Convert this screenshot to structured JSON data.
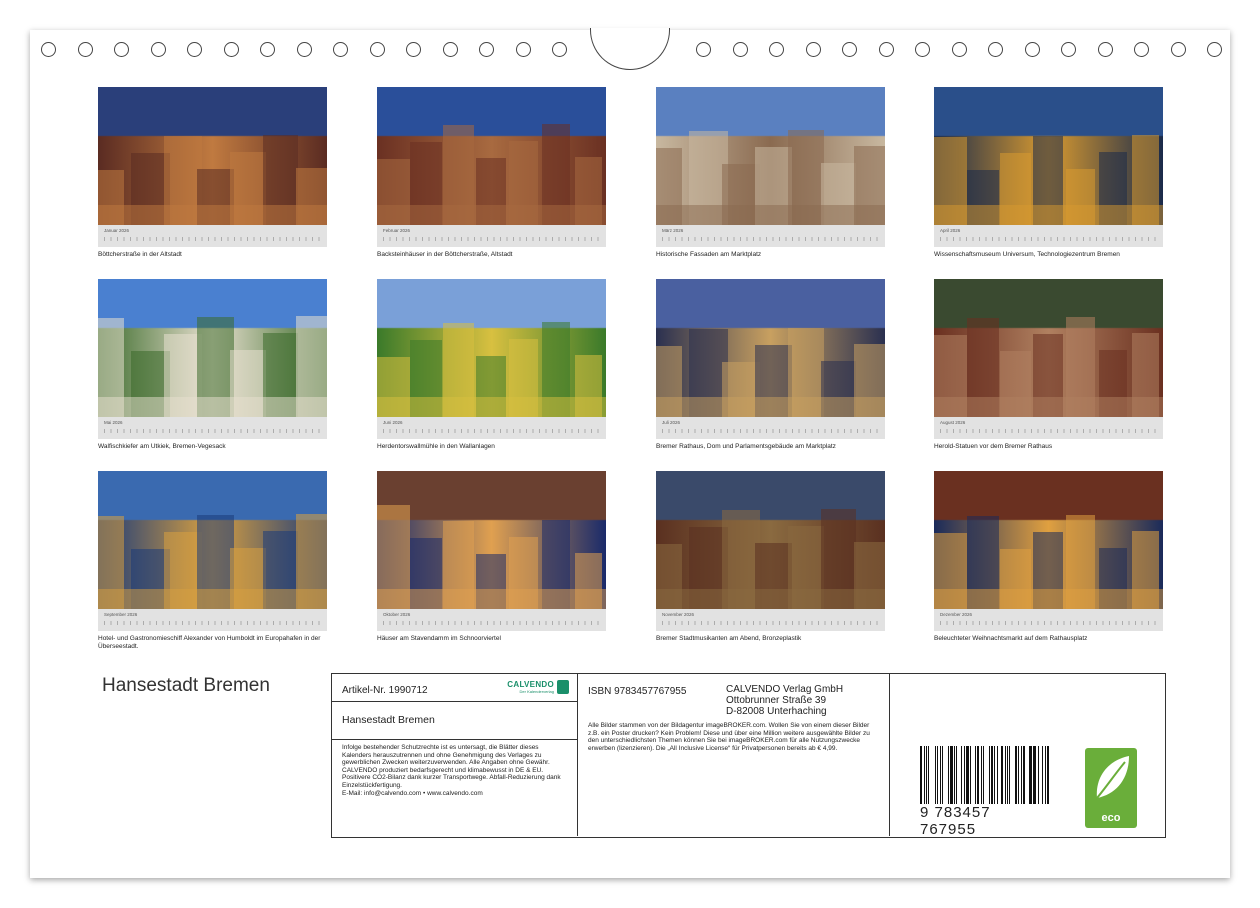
{
  "months": [
    {
      "name": "Januar 2026",
      "caption": "Böttcherstraße in der Altstadt",
      "palette": [
        "#5a2b22",
        "#2a3f7a",
        "#c07a40"
      ]
    },
    {
      "name": "Februar 2026",
      "caption": "Backsteinhäuser in der Böttcherstraße, Altstadt",
      "palette": [
        "#6a3022",
        "#2a4f9a",
        "#a86a40"
      ]
    },
    {
      "name": "März 2026",
      "caption": "Historische Fassaden am Marktplatz",
      "palette": [
        "#c8b8a0",
        "#5a80c0",
        "#8a6a50"
      ]
    },
    {
      "name": "April 2026",
      "caption": "Wissenschaftsmuseum Universum, Technologiezentrum Bremen",
      "palette": [
        "#1a2a4a",
        "#2a4f8a",
        "#d89a30"
      ]
    },
    {
      "name": "Mai 2026",
      "caption": "Walfischkiefer am Utkiek, Bremen-Vegesack",
      "palette": [
        "#3a6a2a",
        "#4a80d0",
        "#e8e0d0"
      ]
    },
    {
      "name": "Juni 2026",
      "caption": "Herdentorswallmühle in den Wallanlagen",
      "palette": [
        "#3a7a2a",
        "#7aa0d8",
        "#d8c040"
      ]
    },
    {
      "name": "Juli 2026",
      "caption": "Bremer Rathaus, Dom und Parlamentsgebäude am Marktplatz",
      "palette": [
        "#2a3050",
        "#4a60a0",
        "#c8a060"
      ]
    },
    {
      "name": "August 2026",
      "caption": "Herold-Statuen vor dem Bremer Rathaus",
      "palette": [
        "#6a3020",
        "#3a4a30",
        "#b08060"
      ]
    },
    {
      "name": "September 2026",
      "caption": "Hotel- und Gastronomieschiff Alexander von Humboldt im Europahafen in der Überseestadt.",
      "palette": [
        "#1a3a7a",
        "#3a6ab0",
        "#d8a040"
      ]
    },
    {
      "name": "Oktober 2026",
      "caption": "Häuser am Stavendamm im Schnoorviertel",
      "palette": [
        "#1a2a6a",
        "#6a4030",
        "#e0a050"
      ]
    },
    {
      "name": "November 2026",
      "caption": "Bremer Stadtmusikanten am Abend, Bronzeplastik",
      "palette": [
        "#5a3020",
        "#3a4a6a",
        "#8a6a40"
      ]
    },
    {
      "name": "Dezember 2026",
      "caption": "Beleuchteter Weihnachtsmarkt auf dem Rathausplatz",
      "palette": [
        "#1a2a5a",
        "#6a3020",
        "#e0a040"
      ]
    }
  ],
  "title": "Hansestadt Bremen",
  "panel": {
    "article": "Artikel-Nr. 1990712",
    "logo_text": "CALVENDO",
    "logo_sub": "Der Kalenderverlag",
    "product_title": "Hansestadt Bremen",
    "legal": "Infolge bestehender Schutzrechte ist es untersagt, die Blätter dieses Kalenders herauszutrennen und ohne Genehmigung des Verlages zu gewerblichen Zwecken weiterzuverwenden. Alle Angaben ohne Gewähr.",
    "legal2": "CALVENDO produziert bedarfsgerecht und klimabewusst in DE & EU. Positivere CO2-Bilanz dank kurzer Transportwege. Abfall-Reduzierung dank Einzelstückfertigung.",
    "legal3": "E-Mail: info@calvendo.com • www.calvendo.com",
    "isbn": "ISBN 9783457767955",
    "publisher1": "CALVENDO Verlag GmbH",
    "publisher2": "Ottobrunner Straße 39",
    "publisher3": "D-82008 Unterhaching",
    "image_info": "Alle Bilder stammen von der Bildagentur imageBROKER.com. Wollen Sie von einem dieser Bilder z.B. ein Poster drucken? Kein Problem! Diese und über eine Million weitere ausgewählte Bilder zu den unterschiedlichsten Themen können Sie bei imageBROKER.com für alle Nutzungszwecke erwerben (lizenzieren). Die „All Inclusive License“ für Privatpersonen bereits ab € 4,99.",
    "barcode_number": "9 783457 767955",
    "eco_label": "eco"
  }
}
